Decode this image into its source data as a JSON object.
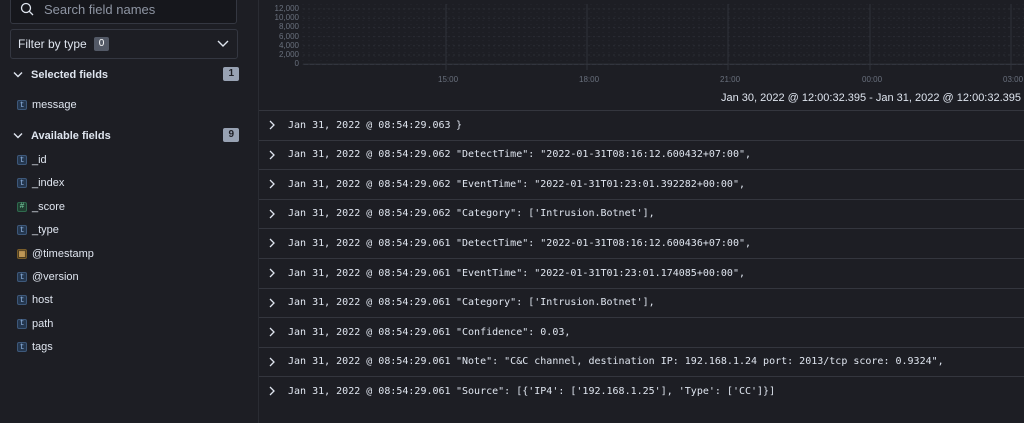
{
  "sidebar": {
    "search_placeholder": "Search field names",
    "filter": {
      "label": "Filter by type",
      "count": "0"
    },
    "selected": {
      "title": "Selected fields",
      "count": "1",
      "fields": [
        {
          "name": "message",
          "type": "string"
        }
      ]
    },
    "available": {
      "title": "Available fields",
      "count": "9",
      "fields": [
        {
          "name": "_id",
          "type": "string"
        },
        {
          "name": "_index",
          "type": "string"
        },
        {
          "name": "_score",
          "type": "number"
        },
        {
          "name": "_type",
          "type": "string"
        },
        {
          "name": "@timestamp",
          "type": "date"
        },
        {
          "name": "@version",
          "type": "string"
        },
        {
          "name": "host",
          "type": "string"
        },
        {
          "name": "path",
          "type": "string"
        },
        {
          "name": "tags",
          "type": "string"
        }
      ]
    }
  },
  "histogram": {
    "y_ticks": [
      "12,000",
      "10,000",
      "8,000",
      "6,000",
      "4,000",
      "2,000",
      "0"
    ],
    "x_ticks": [
      "15:00",
      "18:00",
      "21:00",
      "00:00",
      "03:00"
    ],
    "time_range": "Jan 30, 2022 @ 12:00:32.395 - Jan 31, 2022 @ 12:00:32.395"
  },
  "rows": [
    {
      "timestamp": "Jan 31, 2022 @ 08:54:29.063",
      "message": "}"
    },
    {
      "timestamp": "Jan 31, 2022 @ 08:54:29.062",
      "message": "\"DetectTime\": \"2022-01-31T08:16:12.600432+07:00\","
    },
    {
      "timestamp": "Jan 31, 2022 @ 08:54:29.062",
      "message": "\"EventTime\": \"2022-01-31T01:23:01.392282+00:00\","
    },
    {
      "timestamp": "Jan 31, 2022 @ 08:54:29.062",
      "message": "\"Category\": ['Intrusion.Botnet'],"
    },
    {
      "timestamp": "Jan 31, 2022 @ 08:54:29.061",
      "message": "\"DetectTime\": \"2022-01-31T08:16:12.600436+07:00\","
    },
    {
      "timestamp": "Jan 31, 2022 @ 08:54:29.061",
      "message": "\"EventTime\": \"2022-01-31T01:23:01.174085+00:00\","
    },
    {
      "timestamp": "Jan 31, 2022 @ 08:54:29.061",
      "message": "\"Category\": ['Intrusion.Botnet'],"
    },
    {
      "timestamp": "Jan 31, 2022 @ 08:54:29.061",
      "message": "\"Confidence\": 0.03,"
    },
    {
      "timestamp": "Jan 31, 2022 @ 08:54:29.061",
      "message": "\"Note\": \"C&C channel, destination IP: 192.168.1.24 port: 2013/tcp score: 0.9324\","
    },
    {
      "timestamp": "Jan 31, 2022 @ 08:54:29.061",
      "message": "\"Source\": [{'IP4': ['192.168.1.25'], 'Type': ['CC']}]"
    }
  ]
}
